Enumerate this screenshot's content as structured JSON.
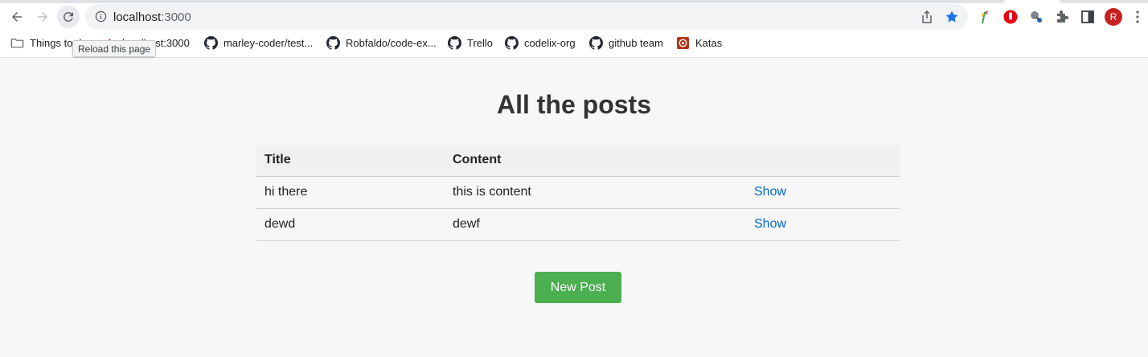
{
  "browser": {
    "address": {
      "host": "localhost",
      "port": ":3000"
    },
    "tooltip": "Reload this page",
    "avatar_initial": "R",
    "bookmarks": [
      {
        "label": "Things to do",
        "icon": "folder-icon"
      },
      {
        "label": "localhost:3000",
        "icon": "localhost-icon"
      },
      {
        "label": "marley-coder/test...",
        "icon": "github-icon"
      },
      {
        "label": "Robfaldo/code-ex...",
        "icon": "github-icon"
      },
      {
        "label": "Trello",
        "icon": "github-icon"
      },
      {
        "label": "codelix-org",
        "icon": "github-icon"
      },
      {
        "label": "github team",
        "icon": "github-icon"
      },
      {
        "label": "Katas",
        "icon": "codewars-icon"
      }
    ]
  },
  "page": {
    "title": "All the posts",
    "table": {
      "headers": [
        "Title",
        "Content",
        ""
      ],
      "rows": [
        {
          "title": "hi there",
          "content": "this is content",
          "action": "Show"
        },
        {
          "title": "dewd",
          "content": "dewf",
          "action": "Show"
        }
      ]
    },
    "new_post_label": "New Post"
  },
  "colors": {
    "accent_button": "#4caf50",
    "link": "#0066cc",
    "star": "#1a73e8",
    "avatar": "#c5221f"
  }
}
